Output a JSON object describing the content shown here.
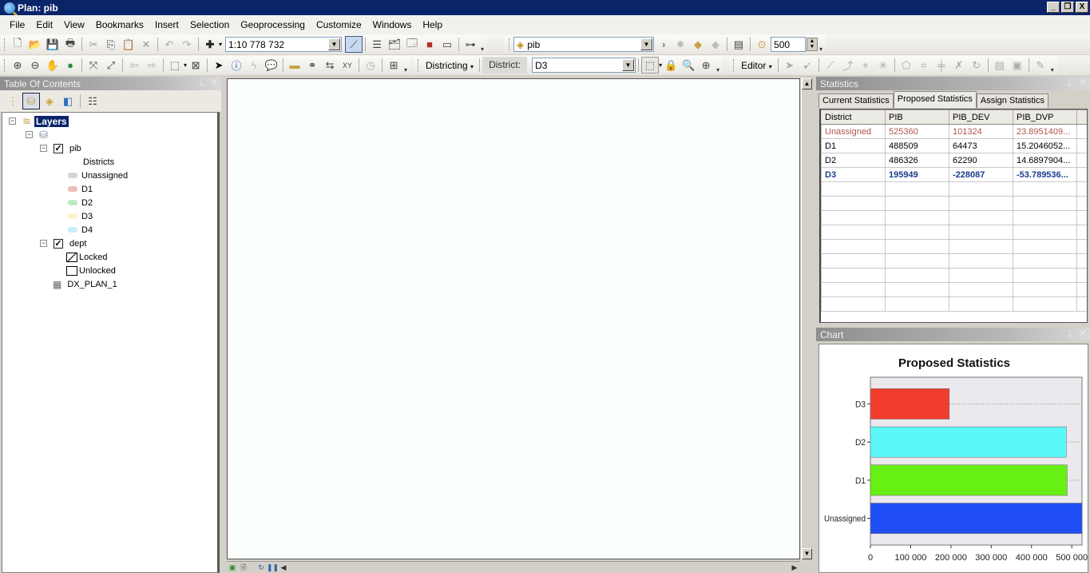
{
  "window": {
    "title": "Plan: pib",
    "controls": [
      "_",
      "❐",
      "X"
    ]
  },
  "menu": [
    "File",
    "Edit",
    "View",
    "Bookmarks",
    "Insert",
    "Selection",
    "Geoprocessing",
    "Customize",
    "Windows",
    "Help"
  ],
  "toolbar": {
    "scale_value": "1:10 778 732",
    "layer_combo_value": "pib",
    "tolerance_value": "500",
    "districting_label": "Districting",
    "district_label": "District:",
    "district_value": "D3",
    "editor_label": "Editor"
  },
  "toc": {
    "title": "Table Of Contents",
    "root_label": "Layers",
    "layers": [
      {
        "name": "pib",
        "checked": true,
        "legend_heading": "Districts",
        "legend": [
          {
            "label": "Unassigned",
            "color": "#d0d0d0"
          },
          {
            "label": "D1",
            "color": "#eeb6b6"
          },
          {
            "label": "D2",
            "color": "#b8e8b8"
          },
          {
            "label": "D3",
            "color": "#fbf3c0"
          },
          {
            "label": "D4",
            "color": "#c2ecf6"
          }
        ]
      },
      {
        "name": "dept",
        "checked": true,
        "legend": [
          {
            "label": "Locked"
          },
          {
            "label": "Unlocked"
          }
        ]
      }
    ],
    "table_name": "DX_PLAN_1"
  },
  "statistics": {
    "title": "Statistics",
    "tabs": [
      "Current Statistics",
      "Proposed Statistics",
      "Assign Statistics"
    ],
    "active_tab": 1,
    "columns": [
      "District",
      "PIB",
      "PIB_DEV",
      "PIB_DVP"
    ],
    "rows": [
      {
        "cells": [
          "Unassigned",
          "525360",
          "101324",
          "23.8951409..."
        ],
        "style": "unassigned"
      },
      {
        "cells": [
          "D1",
          "488509",
          "64473",
          "15.2046052..."
        ],
        "style": "normal"
      },
      {
        "cells": [
          "D2",
          "486326",
          "62290",
          "14.6897904..."
        ],
        "style": "normal"
      },
      {
        "cells": [
          "D3",
          "195949",
          "-228087",
          "-53.789536..."
        ],
        "style": "active"
      }
    ],
    "empty_rows": 9
  },
  "chart_panel": {
    "title": "Chart"
  },
  "chart_data": {
    "type": "bar",
    "orientation": "horizontal",
    "title": "Proposed Statistics",
    "categories": [
      "Unassigned",
      "D1",
      "D2",
      "D3"
    ],
    "values": [
      525360,
      488509,
      486326,
      195949
    ],
    "colors": [
      "#1f4ef5",
      "#66f014",
      "#5cf8f8",
      "#f23c2c"
    ],
    "xlabel": "",
    "ylabel": "",
    "xlim": [
      0,
      525360
    ],
    "xticks": [
      0,
      100000,
      200000,
      300000,
      400000,
      500000
    ],
    "xtick_labels": [
      "0",
      "100 000",
      "200 000",
      "300 000",
      "400 000",
      "500 000"
    ],
    "grid": "dotted horizontal at category",
    "legend": "none"
  }
}
